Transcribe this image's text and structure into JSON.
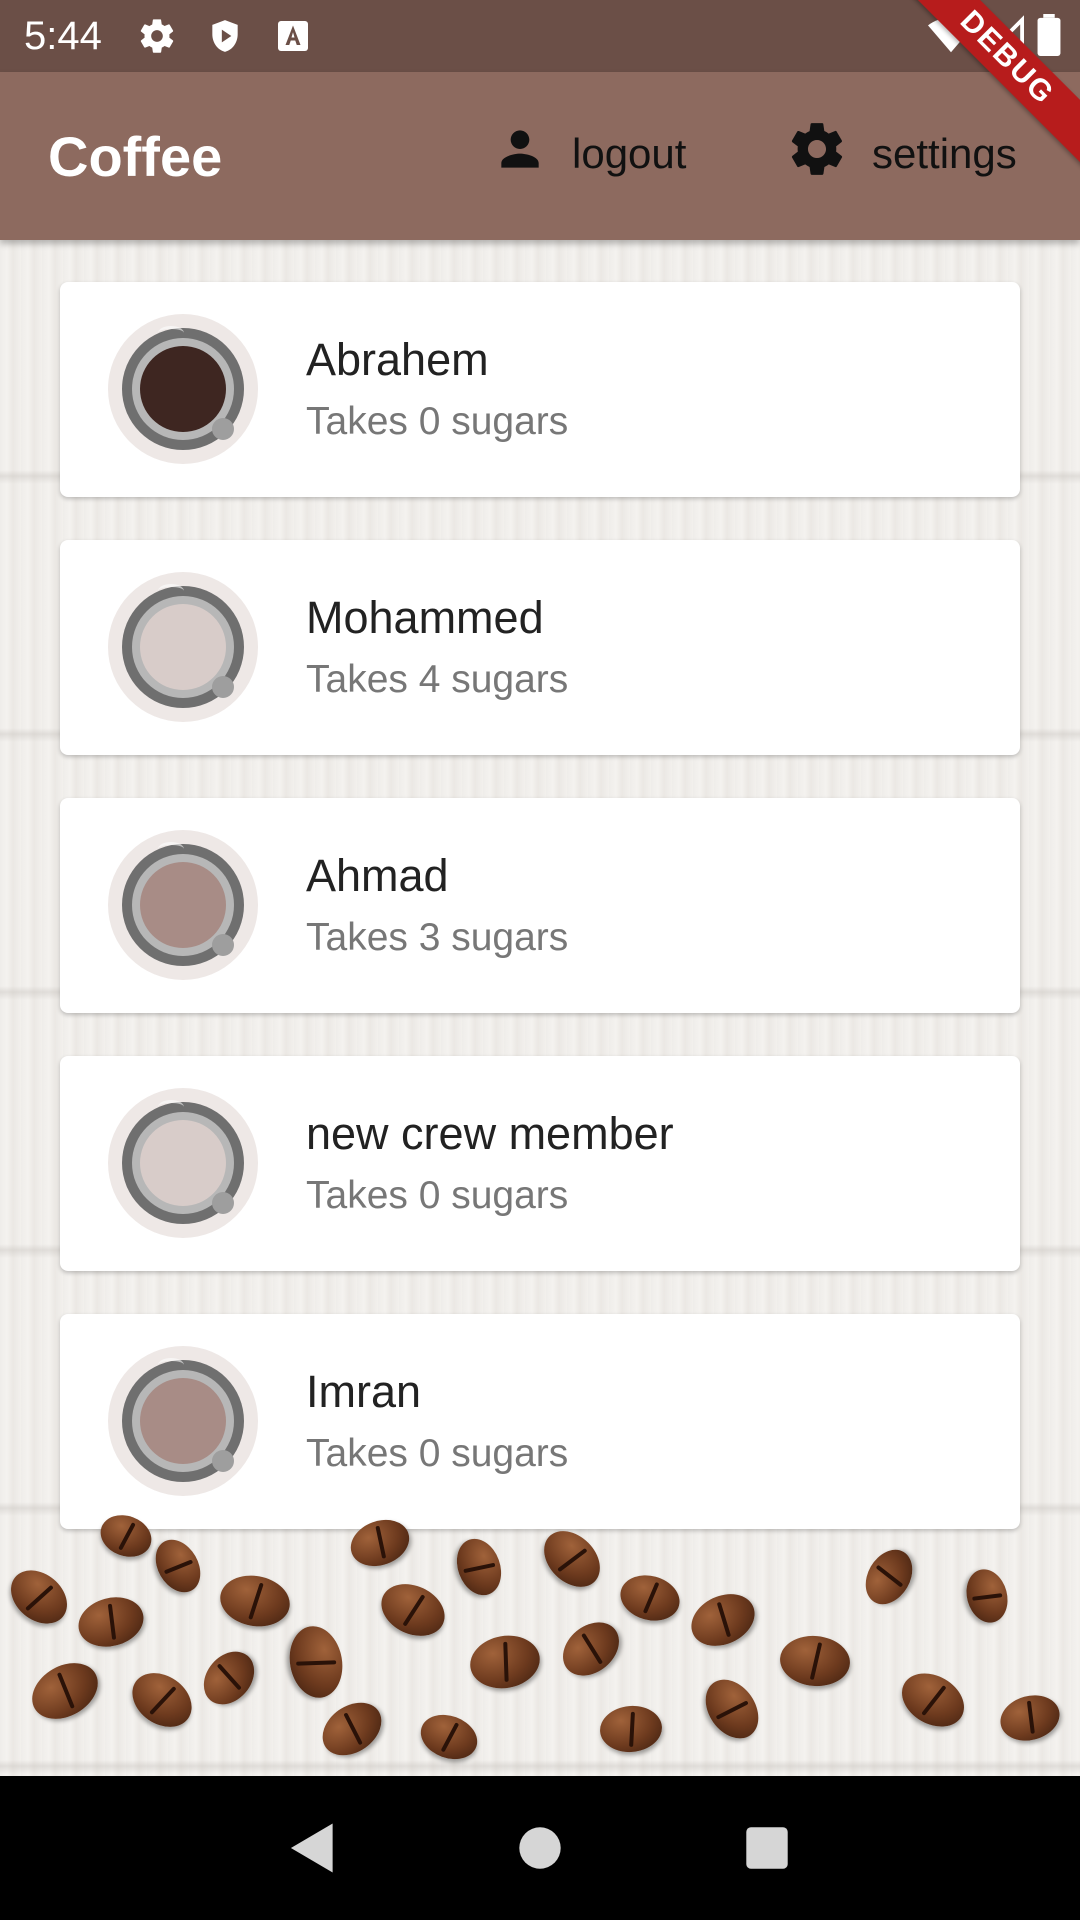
{
  "status_bar": {
    "time": "5:44",
    "left_icons": [
      "gear-icon",
      "shield-play-icon",
      "a-box-icon"
    ],
    "right_icons": [
      "wifi-icon",
      "signal-icon",
      "battery-icon"
    ]
  },
  "debug_banner": "DEBUG",
  "app_bar": {
    "title": "Coffee",
    "logout_label": "logout",
    "settings_label": "settings",
    "color": "#8d6a5f"
  },
  "crew": [
    {
      "name": "Abrahem",
      "subtitle": "Takes 0 sugars",
      "coffee_color": "#3e2621"
    },
    {
      "name": "Mohammed",
      "subtitle": "Takes 4 sugars",
      "coffee_color": "#d8ccc9"
    },
    {
      "name": "Ahmad",
      "subtitle": "Takes 3 sugars",
      "coffee_color": "#a88c86"
    },
    {
      "name": "new crew member",
      "subtitle": "Takes 0 sugars",
      "coffee_color": "#d8ccc9"
    },
    {
      "name": "Imran",
      "subtitle": "Takes 0 sugars",
      "coffee_color": "#a88c86"
    }
  ],
  "nav_bar": {
    "buttons": [
      "back-icon",
      "home-icon",
      "recents-icon"
    ]
  }
}
